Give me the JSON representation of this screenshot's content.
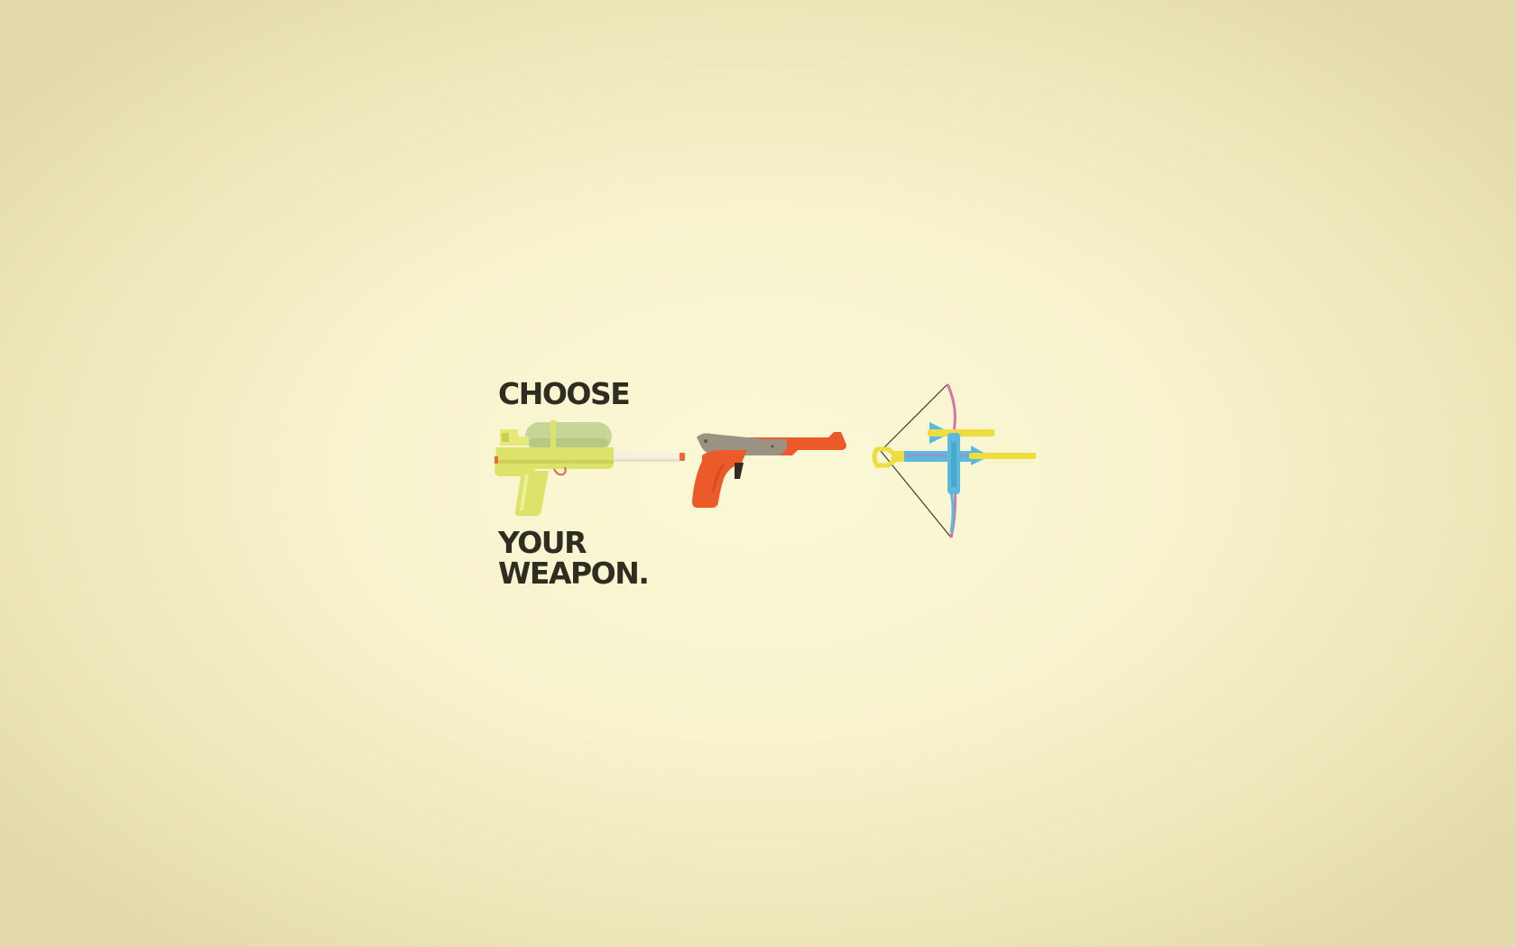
{
  "headline": {
    "line1": "CHOOSE",
    "line2": "YOUR",
    "line3": "WEAPON."
  },
  "colors": {
    "background": "#f8f3cd",
    "text": "#2f2c22",
    "water_gun_body": "#dde36a",
    "water_gun_tank": "#c6d698",
    "zapper_orange": "#ed5a2a",
    "zapper_gray": "#9a9384",
    "crossbow_blue": "#5ab9de",
    "crossbow_yellow": "#eedd3c",
    "crossbow_limb": "#d276ac"
  },
  "weapons": [
    {
      "icon": "water-gun-icon"
    },
    {
      "icon": "zapper-light-gun-icon"
    },
    {
      "icon": "crossbow-icon"
    }
  ]
}
